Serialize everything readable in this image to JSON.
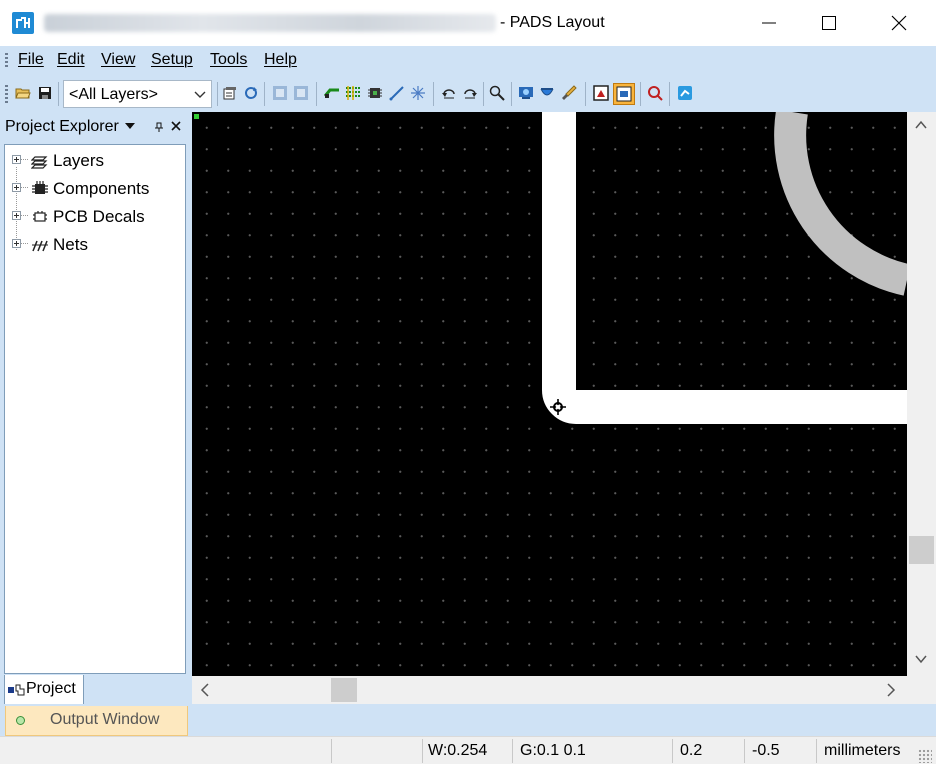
{
  "window": {
    "title_suffix": "- PADS Layout",
    "app_icon": "pads-layout-icon",
    "controls": [
      "minimize-icon",
      "maximize-icon",
      "close-icon"
    ]
  },
  "menu": {
    "items": [
      "File",
      "Edit",
      "View",
      "Setup",
      "Tools",
      "Help"
    ]
  },
  "toolbar": {
    "layer_select_value": "<All Layers>",
    "icons": [
      "open-folder-icon",
      "save-icon",
      "properties-icon",
      "refresh-icon",
      "copy-icon",
      "paste-icon",
      "route-icon",
      "nets-icon",
      "component-icon",
      "connect-icon",
      "spread-icon",
      "undo-icon",
      "redo-icon",
      "zoom-icon",
      "view-icon",
      "highlight-icon",
      "brush-icon",
      "display-icon",
      "layer-mode-icon",
      "verify-icon",
      "router-icon"
    ]
  },
  "explorer": {
    "title": "Project Explorer",
    "header_icons": [
      "menu-arrow-icon",
      "pin-icon",
      "close-icon"
    ],
    "tree": [
      {
        "label": "Layers",
        "icon": "layers-icon"
      },
      {
        "label": "Components",
        "icon": "component-icon"
      },
      {
        "label": "PCB Decals",
        "icon": "decal-icon"
      },
      {
        "label": "Nets",
        "icon": "nets-icon"
      }
    ],
    "tab_label": "Project"
  },
  "canvas": {
    "background": "#000000",
    "trace_color": "#ffffff",
    "arc_color": "#c0c0c0",
    "grid_dot_color": "#5a5a5a",
    "origin_color": "#33cc33"
  },
  "output": {
    "label": "Output Window"
  },
  "status": {
    "width": "W:0.254",
    "grid": "G:0.1 0.1",
    "x": "0.2",
    "y": "-0.5",
    "units": "millimeters"
  },
  "colors": {
    "chrome": "#cfe2f5",
    "output_tab": "#fde8bf",
    "accent": "#1f8ad4"
  }
}
